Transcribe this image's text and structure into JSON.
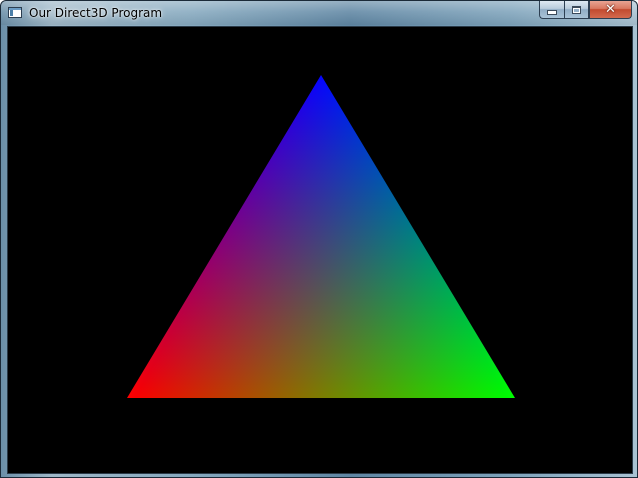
{
  "window": {
    "title": "Our Direct3D Program",
    "icon": "application-window-icon",
    "caption_buttons": {
      "minimize": "minimize-icon",
      "maximize": "maximize-icon",
      "close": "close-icon"
    },
    "close_glyph": "✕"
  },
  "scene": {
    "background_color": "#000000",
    "triangle": {
      "vertices": [
        {
          "name": "top",
          "color": "#0000ff"
        },
        {
          "name": "bottom-right",
          "color": "#00ff00"
        },
        {
          "name": "bottom-left",
          "color": "#ff0000"
        }
      ]
    }
  }
}
